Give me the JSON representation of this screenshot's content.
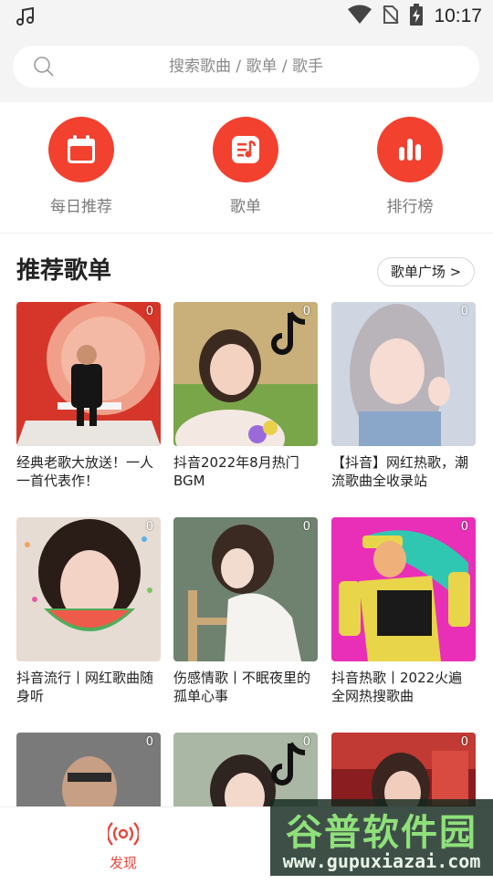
{
  "status_bar": {
    "time": "10:17",
    "icons": [
      "music-note-icon",
      "wifi-icon",
      "no-sim-icon",
      "battery-charging-icon"
    ]
  },
  "search": {
    "placeholder": "搜索歌曲 / 歌单 / 歌手",
    "icon": "search-icon"
  },
  "quick_nav": [
    {
      "label": "每日推荐",
      "icon": "calendar-icon"
    },
    {
      "label": "歌单",
      "icon": "playlist-icon"
    },
    {
      "label": "排行榜",
      "icon": "chart-bars-icon"
    }
  ],
  "recommended": {
    "title": "推荐歌单",
    "more_label": "歌单广场 >",
    "playlists": [
      {
        "title": "经典老歌大放送！一人一首代表作！",
        "play_count": "0"
      },
      {
        "title": "抖音2022年8月热门BGM",
        "play_count": "0"
      },
      {
        "title": "【抖音】网红热歌，潮流歌曲全收录站",
        "play_count": "0"
      },
      {
        "title": "抖音流行丨网红歌曲随身听",
        "play_count": "0"
      },
      {
        "title": "伤感情歌丨不眠夜里的孤单心事",
        "play_count": "0"
      },
      {
        "title": "抖音热歌丨2022火遍全网热搜歌曲",
        "play_count": "0"
      },
      {
        "title": "",
        "play_count": "0"
      },
      {
        "title": "",
        "play_count": "0"
      },
      {
        "title": "",
        "play_count": "0"
      }
    ]
  },
  "bottom_nav": {
    "active_label": "发现",
    "active_icon": "radio-broadcast-icon"
  },
  "watermark": {
    "line1": "谷普软件园",
    "line2": "www.gupuxiazai.com"
  },
  "colors": {
    "accent": "#f2412f",
    "active_nav": "#e8453c"
  }
}
